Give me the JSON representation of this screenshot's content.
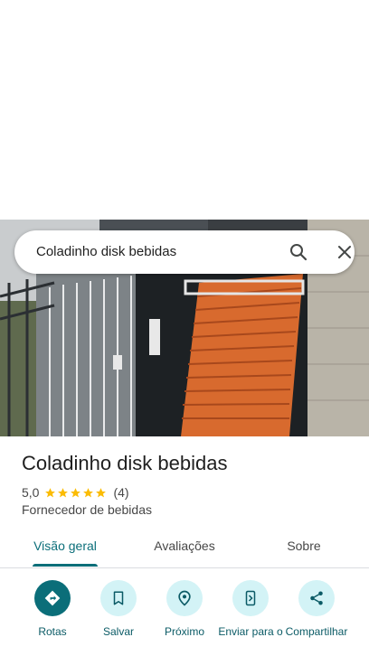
{
  "search": {
    "query": "Coladinho disk bebidas"
  },
  "place": {
    "name": "Coladinho disk bebidas",
    "rating": "5,0",
    "stars": 5,
    "review_count": "(4)",
    "category": "Fornecedor de bebidas"
  },
  "tabs": [
    {
      "label": "Visão geral",
      "active": true
    },
    {
      "label": "Avaliações",
      "active": false
    },
    {
      "label": "Sobre",
      "active": false
    }
  ],
  "actions": [
    {
      "label": "Rotas",
      "icon": "directions-icon"
    },
    {
      "label": "Salvar",
      "icon": "bookmark-icon"
    },
    {
      "label": "Próximo",
      "icon": "nearby-icon"
    },
    {
      "label": "Enviar para o",
      "icon": "send-to-phone-icon"
    },
    {
      "label": "Compartilhar",
      "icon": "share-icon"
    }
  ],
  "colors": {
    "accent": "#0b6e79",
    "chip_bg": "#d3f3f6",
    "star": "#fbbc04"
  }
}
